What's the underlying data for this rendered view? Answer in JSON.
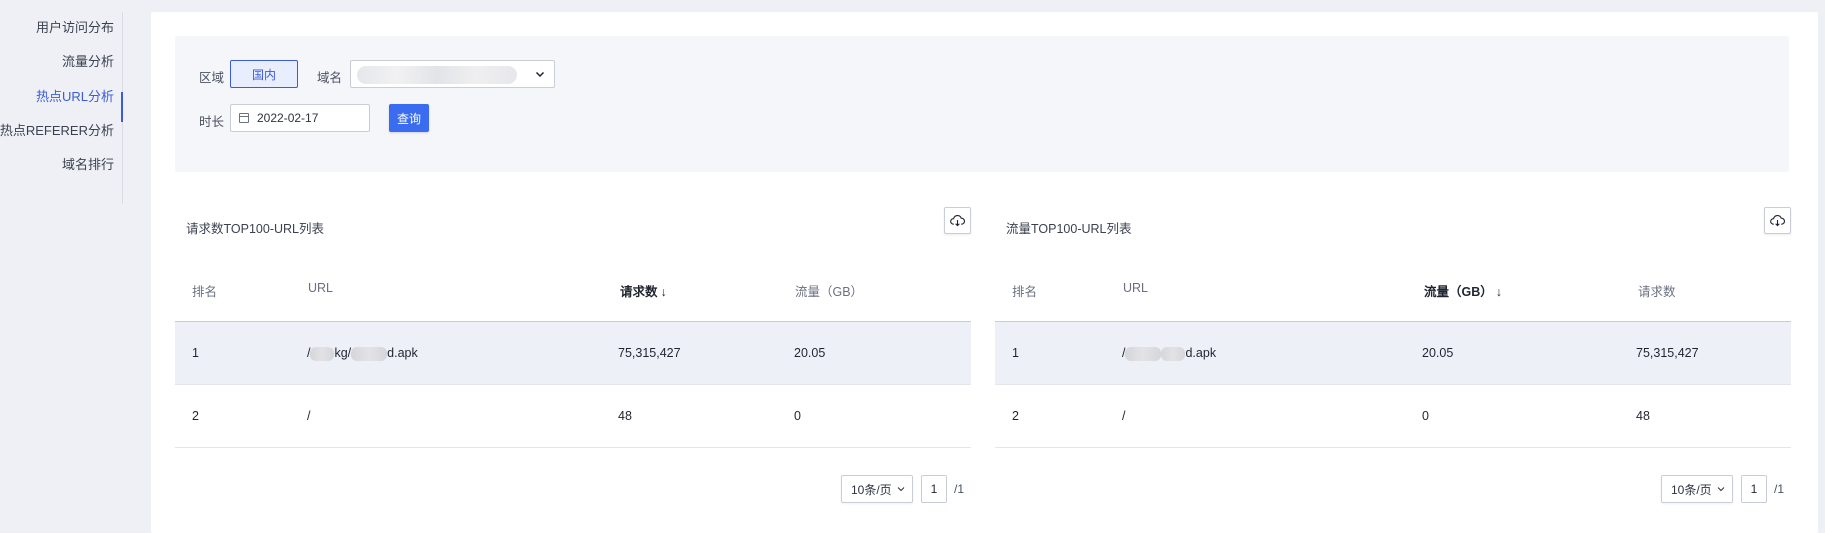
{
  "sidebar": {
    "items": [
      {
        "label": "用户访问分布",
        "active": false
      },
      {
        "label": "流量分析",
        "active": false
      },
      {
        "label": "热点URL分析",
        "active": true
      },
      {
        "label": "热点REFERER分析",
        "active": false
      },
      {
        "label": "域名排行",
        "active": false
      }
    ]
  },
  "filters": {
    "region_label": "区域",
    "region_value": "国内",
    "domain_label": "域名",
    "duration_label": "时长",
    "date_value": "2022-02-17",
    "query_button": "查询"
  },
  "left_panel": {
    "title": "请求数TOP100-URL列表",
    "columns": [
      "排名",
      "URL",
      "请求数",
      "流量（GB）"
    ],
    "sorted_column_arrow": "↓",
    "rows": [
      {
        "rank": "1",
        "url_prefix": "/",
        "url_mid": "kg/",
        "url_suffix": "d.apk",
        "requests": "75,315,427",
        "traffic": "20.05"
      },
      {
        "rank": "2",
        "url": "/",
        "requests": "48",
        "traffic": "0"
      }
    ],
    "page_size": "10条/页",
    "page_current": "1",
    "page_total": "/1"
  },
  "right_panel": {
    "title": "流量TOP100-URL列表",
    "columns": [
      "排名",
      "URL",
      "流量（GB）",
      "请求数"
    ],
    "sorted_column_arrow": "↓",
    "rows": [
      {
        "rank": "1",
        "url_prefix": "/",
        "url_mid": "",
        "url_suffix": "d.apk",
        "traffic": "20.05",
        "requests": "75,315,427"
      },
      {
        "rank": "2",
        "url": "/",
        "traffic": "0",
        "requests": "48"
      }
    ],
    "page_size": "10条/页",
    "page_current": "1",
    "page_total": "/1"
  },
  "colors": {
    "accent": "#3b5bdb",
    "primary_button": "#3b6cf0",
    "page_background": "#eef0f6",
    "highlight_row": "#eef0f7"
  },
  "icons": {
    "calendar": "calendar-icon",
    "download": "cloud-download-icon",
    "dropdown": "chevron-down-icon"
  }
}
